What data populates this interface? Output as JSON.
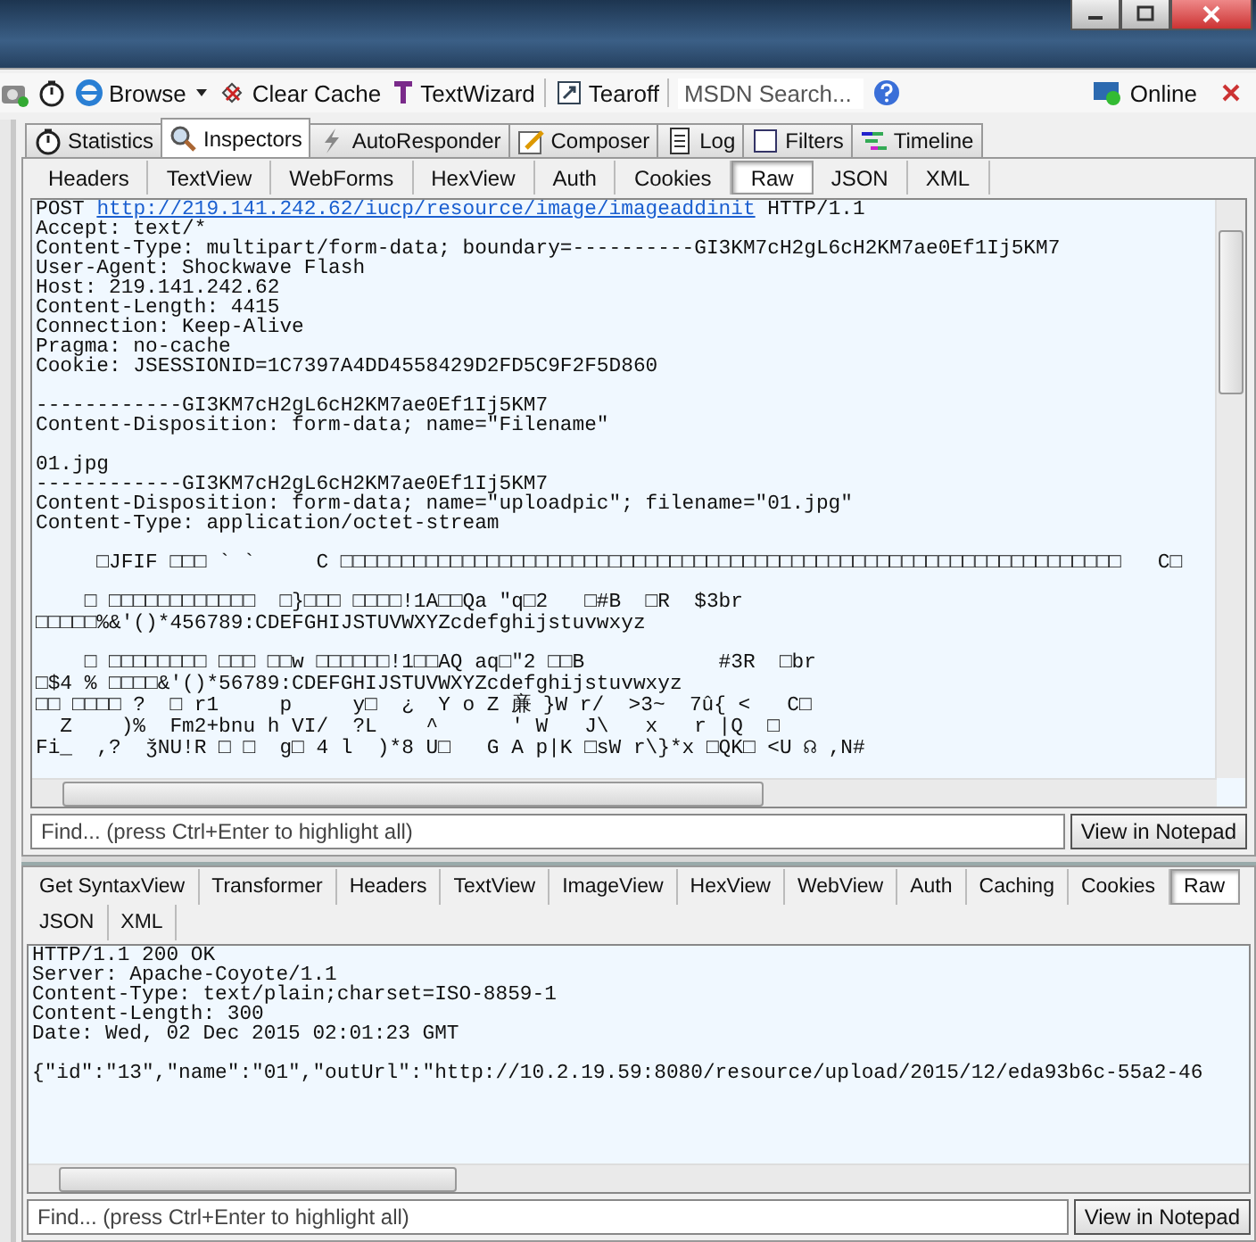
{
  "toolbar": {
    "browse": "Browse",
    "clear_cache": "Clear Cache",
    "text_wizard": "TextWizard",
    "tearoff": "Tearoff",
    "search": {
      "placeholder": "MSDN Search..."
    },
    "online": "Online"
  },
  "tabs": [
    {
      "label": "Statistics",
      "selected": false
    },
    {
      "label": "Inspectors",
      "selected": true
    },
    {
      "label": "AutoResponder",
      "selected": false
    },
    {
      "label": "Composer",
      "selected": false
    },
    {
      "label": "Log",
      "selected": false
    },
    {
      "label": "Filters",
      "selected": false
    },
    {
      "label": "Timeline",
      "selected": false
    }
  ],
  "request": {
    "tabs": [
      {
        "label": "Headers",
        "selected": false
      },
      {
        "label": "TextView",
        "selected": false
      },
      {
        "label": "WebForms",
        "selected": false
      },
      {
        "label": "HexView",
        "selected": false
      },
      {
        "label": "Auth",
        "selected": false
      },
      {
        "label": "Cookies",
        "selected": false
      },
      {
        "label": "Raw",
        "selected": true
      },
      {
        "label": "JSON",
        "selected": false
      },
      {
        "label": "XML",
        "selected": false
      }
    ],
    "request_line": {
      "method": "POST",
      "url": "http://219.141.242.62/iucp/resource/image/imageaddinit",
      "version": "HTTP/1.1"
    },
    "blocks": [
      [
        "Accept: text/*",
        "Content-Type: multipart/form-data; boundary=----------GI3KM7cH2gL6cH2KM7ae0Ef1Ij5KM7",
        "User-Agent: Shockwave Flash",
        "Host: 219.141.242.62",
        "Content-Length: 4415",
        "Connection: Keep-Alive",
        "Pragma: no-cache",
        "Cookie: JSESSIONID=1C7397A4DD4558429D2FD5C9F2F5D860"
      ],
      [
        "------------GI3KM7cH2gL6cH2KM7ae0Ef1Ij5KM7",
        "Content-Disposition: form-data; name=\"Filename\""
      ],
      [
        "01.jpg",
        "------------GI3KM7cH2gL6cH2KM7ae0Ef1Ij5KM7",
        "Content-Disposition: form-data; name=\"uploadpic\"; filename=\"01.jpg\"",
        "Content-Type: application/octet-stream"
      ],
      [
        "     □JFIF □□□ ` `     C □□□□□□□□□□□□□□□□□□□□□□□□□□□□□□□□□□□□□□□□□□□□□□□□□□□□□□□□□□□□□□□□   C□"
      ],
      [
        "    □ □□□□□□□□□□□□  □}□□□ □□□□!1A□□Qa \"q□2   □#B  □R  $3br",
        "□□□□□%&'()*456789:CDEFGHIJSTUVWXYZcdefghijstuvwxyz"
      ],
      [
        "    □ □□□□□□□□ □□□ □□w □□□□□□!1□□AQ aq□\"2 □□B           #3R  □br",
        "□$4 % □□□□&'()*56789:CDEFGHIJSTUVWXYZcdefghijstuvwxyz",
        "□□ □□□□ ?  □ r1     p     y□  ¿  Y o Z 亷 }W r/  >3~  7û{ <   C□",
        "  Z    )%  Fm2+bnu h VI/  ?L    ^      ' W   J\\   x   r |Q  □",
        "Fi_  ,?  ǯNU!R □ □  g□ 4 l  )*8 U□   G A p|K □sW r\\}*x □QK□ <U ☊ ,N#"
      ]
    ],
    "find": {
      "placeholder": "Find... (press Ctrl+Enter to highlight all)"
    },
    "notepad_button": "View in Notepad"
  },
  "response": {
    "tabs": [
      {
        "label": "Get SyntaxView",
        "selected": false
      },
      {
        "label": "Transformer",
        "selected": false
      },
      {
        "label": "Headers",
        "selected": false
      },
      {
        "label": "TextView",
        "selected": false
      },
      {
        "label": "ImageView",
        "selected": false
      },
      {
        "label": "HexView",
        "selected": false
      },
      {
        "label": "WebView",
        "selected": false
      },
      {
        "label": "Auth",
        "selected": false
      },
      {
        "label": "Caching",
        "selected": false
      },
      {
        "label": "Cookies",
        "selected": false
      },
      {
        "label": "Raw",
        "selected": true
      },
      {
        "label": "JSON",
        "selected": false
      },
      {
        "label": "XML",
        "selected": false
      }
    ],
    "blocks": [
      [
        "HTTP/1.1 200 OK",
        "Server: Apache-Coyote/1.1",
        "Content-Type: text/plain;charset=ISO-8859-1",
        "Content-Length: 300",
        "Date: Wed, 02 Dec 2015 02:01:23 GMT"
      ],
      [
        "{\"id\":\"13\",\"name\":\"01\",\"outUrl\":\"http://10.2.19.59:8080/resource/upload/2015/12/eda93b6c-55a2-46"
      ]
    ],
    "find": {
      "placeholder": "Find... (press Ctrl+Enter to highlight all)"
    },
    "notepad_button": "View in Notepad"
  }
}
